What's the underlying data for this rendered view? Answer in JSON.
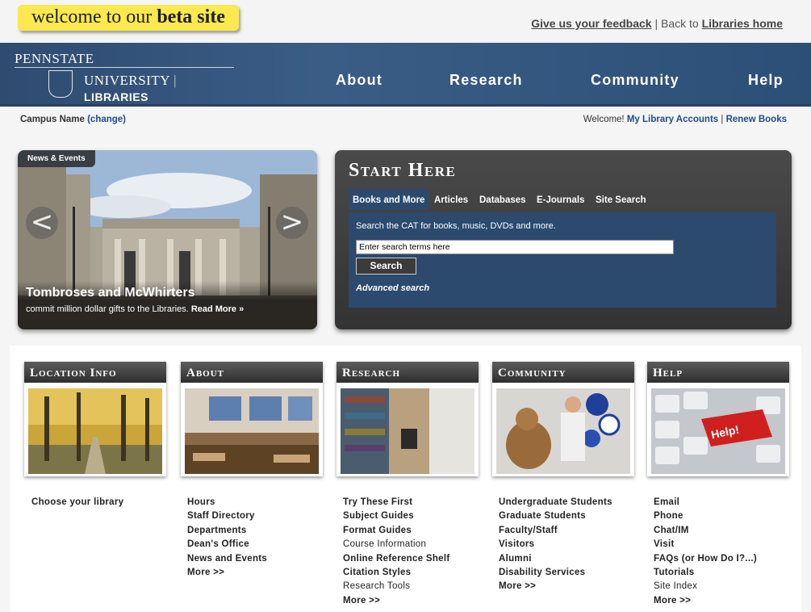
{
  "topbar": {
    "beta_text": "welcome to our",
    "beta_bold": "beta site",
    "feedback_link": "Give us your feedback",
    "separator": "|",
    "back_text": "Back to",
    "libraries_home_link": "Libraries home"
  },
  "header": {
    "logo_pennstate": "PENNSTATE",
    "logo_university": "UNIVERSITY",
    "logo_libraries": "LIBRARIES",
    "nav": [
      "About",
      "Research",
      "Community",
      "Help"
    ]
  },
  "campus": {
    "label": "Campus Name",
    "change": "(change)"
  },
  "welcome": {
    "text": "Welcome!",
    "accounts_link": "My Library Accounts",
    "separator": "|",
    "renew_link": "Renew Books"
  },
  "news": {
    "tag": "News & Events",
    "title": "Tombroses and McWhirters",
    "subtitle": "commit million dollar gifts to the Libraries.",
    "read_more": "Read More »",
    "prev": "<",
    "next": ">"
  },
  "start_here": {
    "title": "Start Here",
    "tabs": [
      "Books and More",
      "Articles",
      "Databases",
      "E-Journals",
      "Site Search"
    ],
    "description": "Search the CAT for books, music, DVDs and more.",
    "search_value": "Enter search terms here",
    "search_button": "Search",
    "advanced_link": "Advanced search"
  },
  "cards": [
    {
      "title": "Location Info",
      "links": [
        {
          "text": "Choose your library",
          "bold": true
        }
      ]
    },
    {
      "title": "About",
      "links": [
        {
          "text": "Hours",
          "bold": true
        },
        {
          "text": "Staff Directory",
          "bold": true
        },
        {
          "text": "Departments",
          "bold": true
        },
        {
          "text": "Dean's Office",
          "bold": true
        },
        {
          "text": "News and Events",
          "bold": true
        },
        {
          "text": "More >>",
          "bold": true
        }
      ]
    },
    {
      "title": "Research",
      "links": [
        {
          "text": "Try These First",
          "bold": true
        },
        {
          "text": "Subject Guides",
          "bold": true
        },
        {
          "text": "Format Guides",
          "bold": true
        },
        {
          "text": "Course Information",
          "bold": false
        },
        {
          "text": "Online Reference Shelf",
          "bold": true
        },
        {
          "text": "Citation Styles",
          "bold": true
        },
        {
          "text": "Research Tools",
          "bold": false
        },
        {
          "text": "More >>",
          "bold": true
        }
      ]
    },
    {
      "title": "Community",
      "links": [
        {
          "text": "Undergraduate Students",
          "bold": true
        },
        {
          "text": "Graduate Students",
          "bold": true
        },
        {
          "text": "Faculty/Staff",
          "bold": true
        },
        {
          "text": "Visitors",
          "bold": true
        },
        {
          "text": "Alumni",
          "bold": true
        },
        {
          "text": "Disability Services",
          "bold": true
        },
        {
          "text": "More >>",
          "bold": true
        }
      ]
    },
    {
      "title": "Help",
      "links": [
        {
          "text": "Email",
          "bold": true
        },
        {
          "text": "Phone",
          "bold": true
        },
        {
          "text": "Chat/IM",
          "bold": true
        },
        {
          "text": "Visit",
          "bold": true
        },
        {
          "text": "FAQs (or How Do I?...)",
          "bold": true
        },
        {
          "text": "Tutorials",
          "bold": true
        },
        {
          "text": "Site Index",
          "bold": false
        },
        {
          "text": "More >>",
          "bold": true
        }
      ]
    }
  ],
  "help_key_label": "Help!",
  "colors": {
    "header_blue": "#34557e",
    "beta_yellow": "#fbe94f",
    "panel_blue": "#2b4a6e",
    "link_blue": "#1f4b8a"
  }
}
